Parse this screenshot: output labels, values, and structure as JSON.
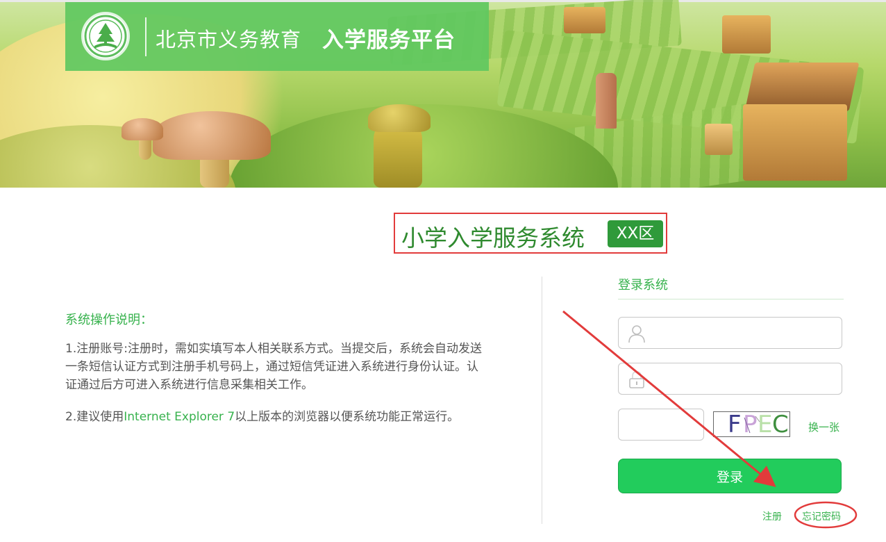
{
  "header": {
    "platform_name_prefix": "北京市义务教育",
    "platform_name_main": "入学服务平台",
    "logo_icon": "education-seal-logo"
  },
  "title": {
    "system_name": "小学入学服务系统",
    "district_badge": "XX区"
  },
  "instructions": {
    "heading": "系统操作说明：",
    "paragraph1": "1.注册账号:注册时，需如实填写本人相关联系方式。当提交后，系统会自动发送一条短信认证方式到注册手机号码上，通过短信凭证进入系统进行身份认证。认证通过后方可进入系统进行信息采集相关工作。",
    "paragraph2_prefix": "2.建议使用",
    "paragraph2_browser": "Internet Explorer 7",
    "paragraph2_suffix": "以上版本的浏览器以便系统功能正常运行。"
  },
  "login": {
    "heading": "登录系统",
    "username_value": "",
    "password_value": "",
    "captcha_value": "",
    "captcha_chars": [
      "F",
      "P",
      "E",
      "C"
    ],
    "captcha_colors": [
      "#3a3a8a",
      "#c9a3d8",
      "#b9e0a8",
      "#3f8f3f"
    ],
    "refresh_label": "换一张",
    "submit_label": "登录",
    "register_label": "注册",
    "forgot_label": "忘记密码",
    "icons": {
      "username": "user-icon",
      "password": "lock-icon"
    }
  },
  "annotations": {
    "highlight_color": "#e23b3b"
  },
  "colors": {
    "brand_green": "#60c860",
    "accent_green": "#37b24d",
    "button_green": "#22cc5c",
    "badge_green": "#2f9a3a"
  }
}
